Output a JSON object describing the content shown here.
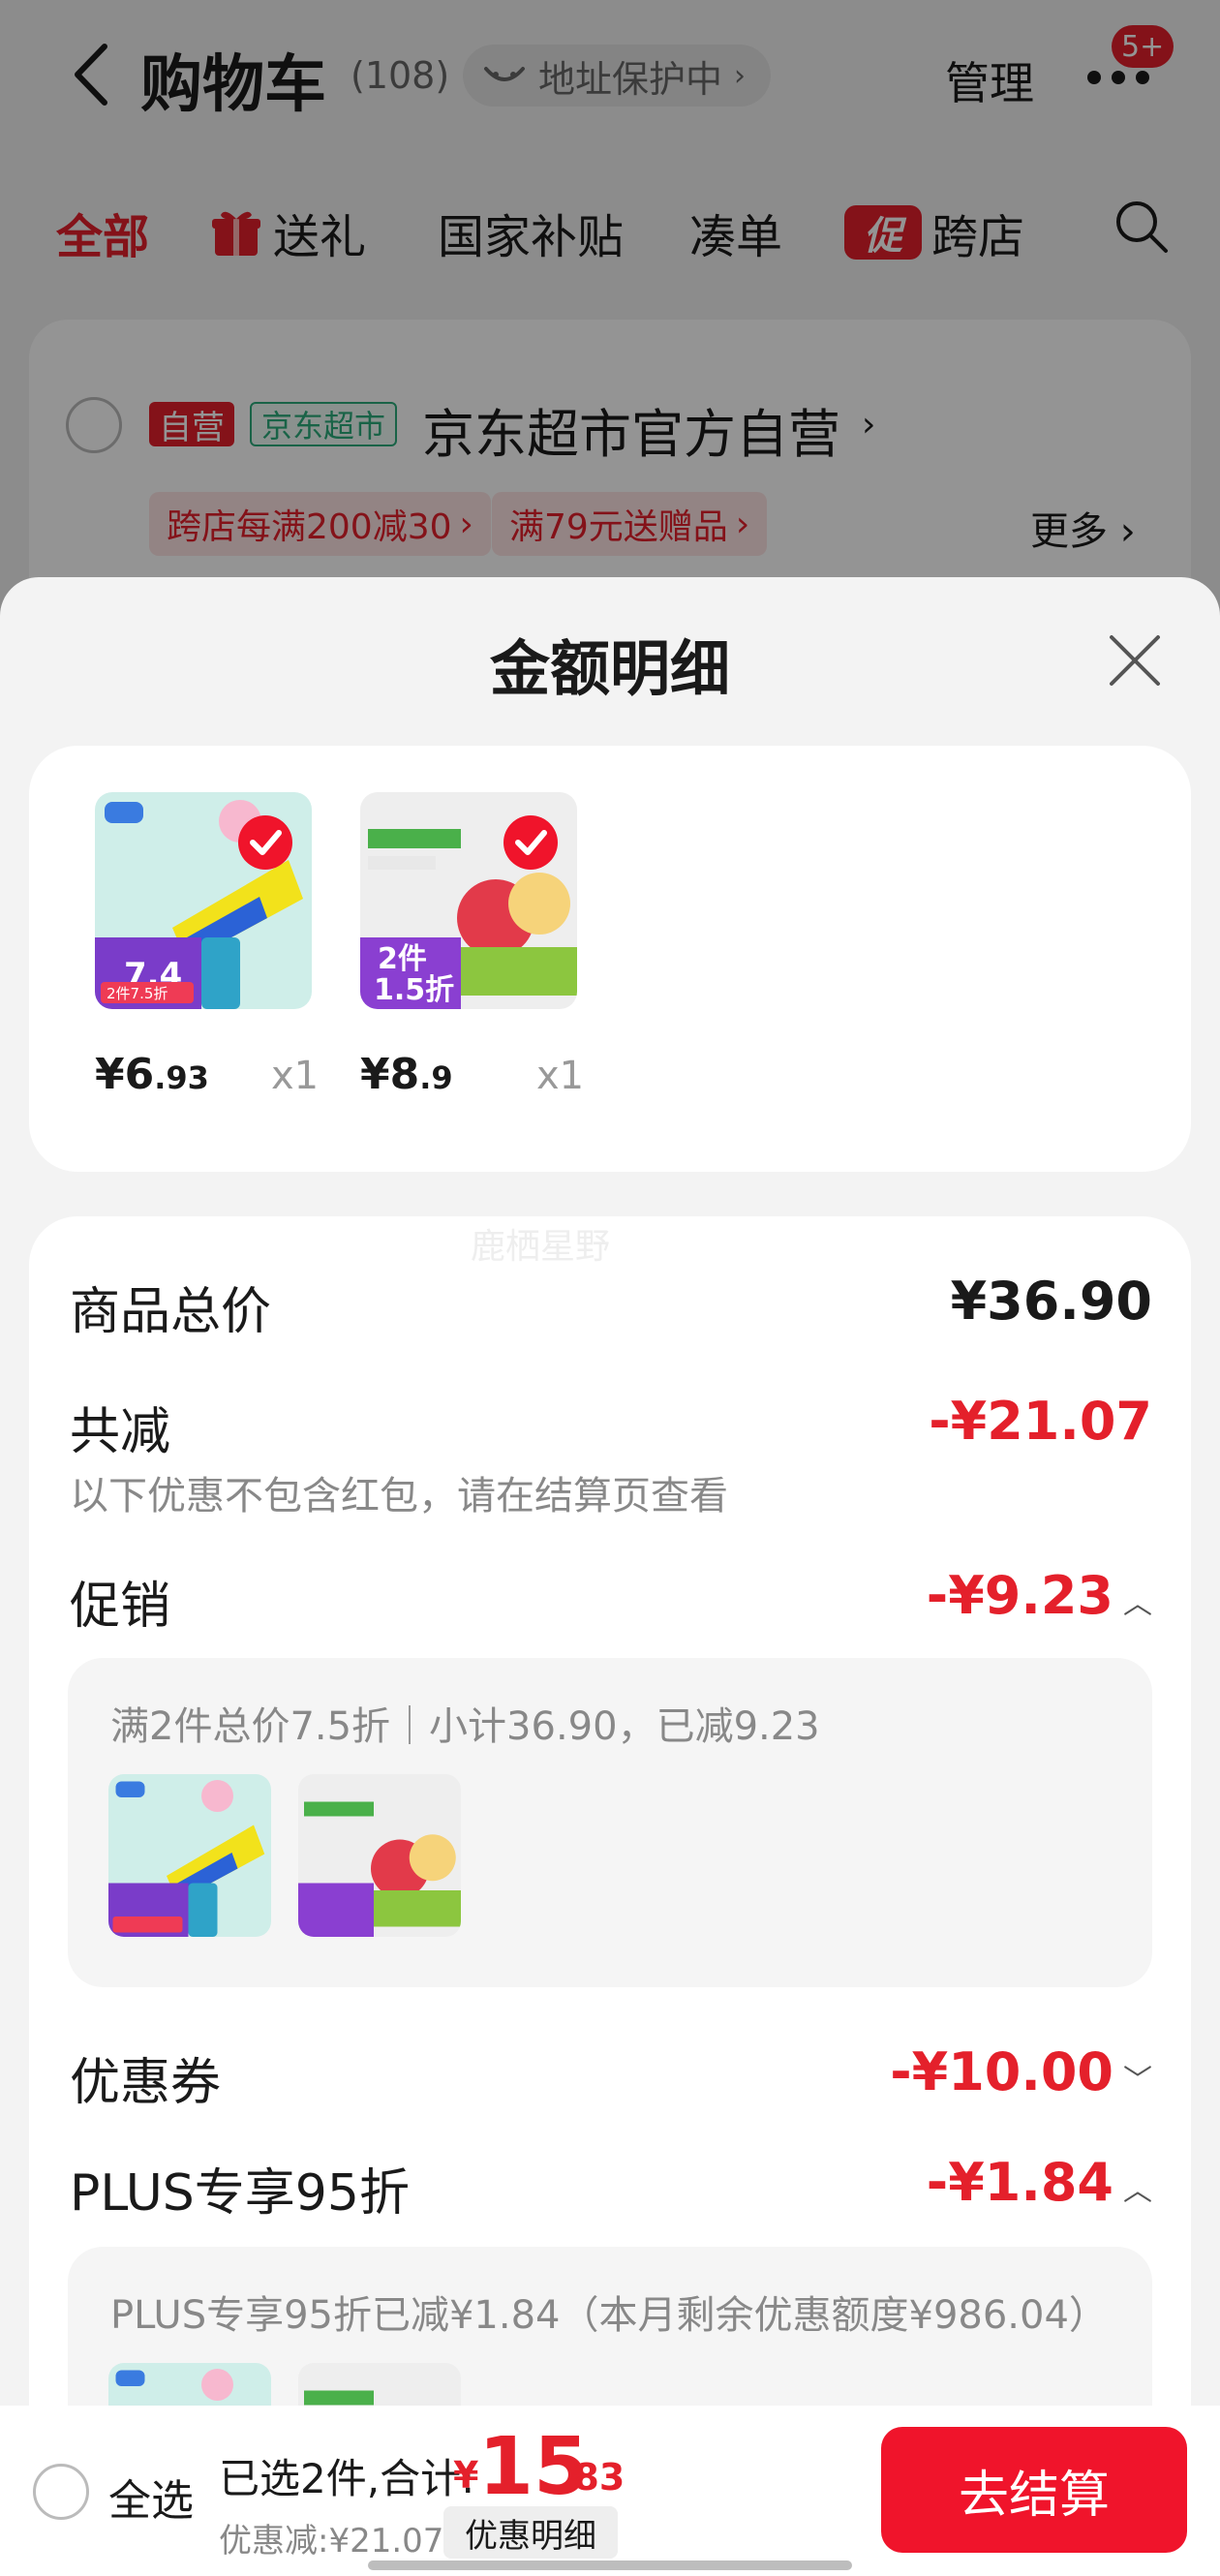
{
  "header": {
    "title": "购物车",
    "count": "(108)",
    "address_badge": "地址保护中",
    "manage_label": "管理",
    "more_badge": "5+"
  },
  "filter_tabs": [
    {
      "label": "全部"
    },
    {
      "label": "送礼"
    },
    {
      "label": "国家补贴"
    },
    {
      "label": "凑单"
    },
    {
      "label": "跨店",
      "icon_text": "促"
    }
  ],
  "store": {
    "tag_self": "自营",
    "tag_market": "京东超市",
    "name": "京东超市官方自营",
    "promos": [
      "跨店每满200减30",
      "满79元送赠品"
    ],
    "more_label": "更多"
  },
  "sheet": {
    "title": "金额明细",
    "items": [
      {
        "price_int": "¥6",
        "price_dec": ".93",
        "qty": "x1",
        "thumb_badge": "7.4",
        "thumb_tag": "2件7.5折"
      },
      {
        "price_int": "¥8",
        "price_dec": ".9",
        "qty": "x1",
        "thumb_badge": "2件",
        "thumb_tag": "1.5折"
      }
    ],
    "watermark": "鹿栖星野",
    "total_label": "商品总价",
    "total_value": "¥36.90",
    "reduce_label": "共减",
    "reduce_value": "-¥21.07",
    "reduce_note": "以下优惠不包含红包，请在结算页查看",
    "promo_label": "促销",
    "promo_value": "-¥9.23",
    "promo_detail": "满2件总价7.5折｜小计36.90，已减9.23",
    "coupon_label": "优惠券",
    "coupon_value": "-¥10.00",
    "plus_label": "PLUS专享95折",
    "plus_value": "-¥1.84",
    "plus_detail": "PLUS专享95折已减¥1.84（本月剩余优惠额度¥986.04）"
  },
  "checkout": {
    "select_all": "全选",
    "summary_label": "已选2件,合计:",
    "currency": "¥",
    "total_int": "15",
    "total_dec": ".83",
    "discount_note": "优惠减:¥21.07",
    "discount_detail_btn": "优惠明细",
    "checkout_btn": "去结算"
  },
  "colors": {
    "accent_red": "#e4202b",
    "checkout_red": "#f0142b",
    "jd_market_green": "#2bab7b"
  }
}
